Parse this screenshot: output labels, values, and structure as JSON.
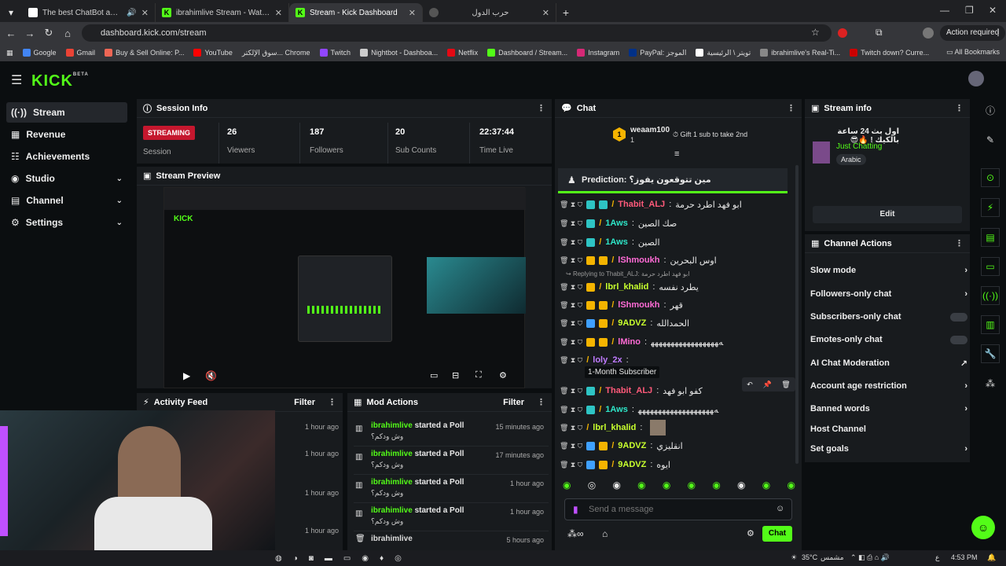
{
  "browser": {
    "tabs": [
      {
        "title": "The best ChatBot and Widg",
        "icon_color": "#ffffff"
      },
      {
        "title": "ibrahimlive Stream - Watch Live",
        "icon_color": "#53fc18"
      },
      {
        "title": "Stream - Kick Dashboard",
        "icon_color": "#53fc18"
      },
      {
        "title": "حرب الدول",
        "icon_color": "#888888"
      }
    ],
    "url": "dashboard.kick.com/stream",
    "action_required": "Action required",
    "bookmarks": [
      "Google",
      "Gmail",
      "Buy & Sell Online: P...",
      "YouTube",
      "سوق الإلكتر... Chrome",
      "Twitch",
      "Nightbot - Dashboa...",
      "Netflix",
      "Dashboard / Stream...",
      "Instagram",
      "PayPal: الموجز",
      "تويتر \\ الرئيسية",
      "ibrahimlive's Real-Ti...",
      "Twitch down? Curre..."
    ],
    "all_bookmarks": "All Bookmarks"
  },
  "sidebar": {
    "items": [
      {
        "label": "Stream",
        "icon": "stream-icon"
      },
      {
        "label": "Revenue",
        "icon": "revenue-icon"
      },
      {
        "label": "Achievements",
        "icon": "achievements-icon"
      },
      {
        "label": "Studio",
        "icon": "studio-icon"
      },
      {
        "label": "Channel",
        "icon": "channel-icon"
      },
      {
        "label": "Settings",
        "icon": "gear-icon"
      }
    ]
  },
  "session": {
    "title": "Session Info",
    "status": "STREAMING",
    "session_label": "Session",
    "stats": [
      {
        "value": "26",
        "label": "Viewers"
      },
      {
        "value": "187",
        "label": "Followers"
      },
      {
        "value": "20",
        "label": "Sub Counts"
      },
      {
        "value": "22:37:44",
        "label": "Time Live"
      }
    ]
  },
  "preview": {
    "title": "Stream Preview"
  },
  "activity": {
    "title": "Activity Feed",
    "filter": "Filter",
    "times": [
      "1 hour ago",
      "1 hour ago",
      "1 hour ago",
      "1 hour ago"
    ]
  },
  "mod_actions": {
    "title": "Mod Actions",
    "filter": "Filter",
    "rows": [
      {
        "user": "ibrahimlive",
        "action": "started a Poll",
        "sub": "وش ودكم؟",
        "time": "15 minutes ago"
      },
      {
        "user": "ibrahimlive",
        "action": "started a Poll",
        "sub": "وش ودكم؟",
        "time": "17 minutes ago"
      },
      {
        "user": "ibrahimlive",
        "action": "started a Poll",
        "sub": "وش ودكم؟",
        "time": "1 hour ago"
      },
      {
        "user": "ibrahimlive",
        "action": "started a Poll",
        "sub": "وش ودكم؟",
        "time": "1 hour ago"
      },
      {
        "user": "ibrahimlive",
        "action": "",
        "sub": "",
        "time": "5 hours ago"
      }
    ]
  },
  "chat": {
    "title": "Chat",
    "gifter": "weaam100",
    "gift_text": "Gift 1 sub to take 2nd",
    "gift_count": "1",
    "prediction": "Prediction: مين تتوقعون يفوز؟",
    "reply_to": "Replying to Thabit_ALJ: ابو فهد اطرد حرمة",
    "tooltip": "1-Month Subscriber",
    "messages": [
      {
        "user": "Thabit_ALJ",
        "color": "#ff5a7a",
        "text": "ابو فهد اطرد حرمة"
      },
      {
        "user": "1Aws",
        "color": "#2ee6c8",
        "text": "صك الصين"
      },
      {
        "user": "1Aws",
        "color": "#2ee6c8",
        "text": "الصين"
      },
      {
        "user": "lShmoukh",
        "color": "#ff6bd6",
        "text": "اوس البحرين"
      },
      {
        "user": "lbrl_khalid",
        "color": "#c8ff2e",
        "text": "يطرد نفسه"
      },
      {
        "user": "lShmoukh",
        "color": "#ff6bd6",
        "text": "قهر"
      },
      {
        "user": "9ADVZ",
        "color": "#c8ff2e",
        "text": "الحمدالله"
      },
      {
        "user": "lMino",
        "color": "#ff6bd6",
        "text": "ﻪﻬﻬﻬﻬﻬﻬﻬﻬﻬﻬﻬﻬﻬﻬﻬﻬﻬ"
      },
      {
        "user": "loly_2x",
        "color": "#c07bff",
        "text": ""
      },
      {
        "user": "Thabit_ALJ",
        "color": "#ff5a7a",
        "text": "كفو ابو فهد"
      },
      {
        "user": "1Aws",
        "color": "#2ee6c8",
        "text": "ﻪﻬﻬﻬﻬﻬﻬﻬﻬﻬﻬﻬﻬﻬﻬﻬﻬﻬﻬﻬ"
      },
      {
        "user": "lbrl_khalid",
        "color": "#c8ff2e",
        "text": ""
      },
      {
        "user": "9ADVZ",
        "color": "#c8ff2e",
        "text": "انقليزي"
      },
      {
        "user": "9ADVZ",
        "color": "#c8ff2e",
        "text": "ايوه"
      }
    ],
    "placeholder": "Send a message",
    "send": "Chat"
  },
  "stream_info": {
    "title": "Stream info",
    "stream_title": "اول بث 24 ساعة بالكيك ! 🔥😎",
    "category": "Just Chatting",
    "language": "Arabic",
    "edit": "Edit"
  },
  "channel_actions": {
    "title": "Channel Actions",
    "items": [
      {
        "label": "Slow mode",
        "control": "chevron"
      },
      {
        "label": "Followers-only chat",
        "control": "chevron"
      },
      {
        "label": "Subscribers-only chat",
        "control": "toggle"
      },
      {
        "label": "Emotes-only chat",
        "control": "toggle"
      },
      {
        "label": "AI Chat Moderation",
        "control": "external"
      },
      {
        "label": "Account age restriction",
        "control": "chevron"
      },
      {
        "label": "Banned words",
        "control": "chevron"
      },
      {
        "label": "Host Channel",
        "control": "none"
      },
      {
        "label": "Set goals",
        "control": "chevron"
      }
    ]
  },
  "taskbar": {
    "temp": "35°C",
    "weather": "مشمس",
    "time": "4:53 PM",
    "lang": "ع"
  },
  "colors": {
    "kick_green": "#53fc18",
    "panel": "#181b1e",
    "bg": "#0b0e10"
  }
}
